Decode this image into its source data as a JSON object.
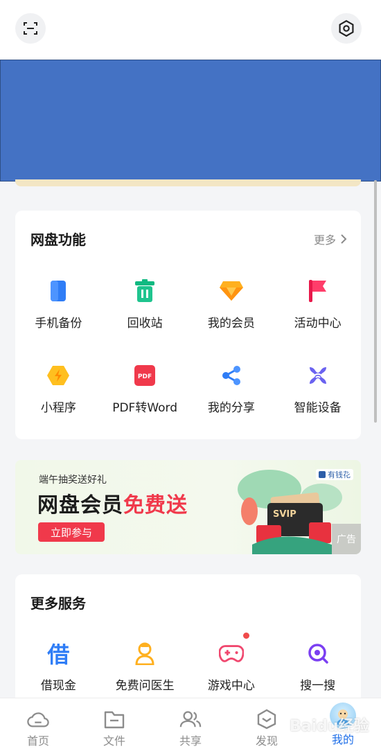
{
  "netdisk": {
    "title": "网盘功能",
    "more_label": "更多",
    "items": [
      {
        "label": "手机备份",
        "icon": "phone-backup-icon"
      },
      {
        "label": "回收站",
        "icon": "recycle-bin-icon"
      },
      {
        "label": "我的会员",
        "icon": "membership-diamond-icon"
      },
      {
        "label": "活动中心",
        "icon": "activity-flag-icon"
      },
      {
        "label": "小程序",
        "icon": "mini-program-icon"
      },
      {
        "label": "PDF转Word",
        "icon": "pdf-icon"
      },
      {
        "label": "我的分享",
        "icon": "share-icon"
      },
      {
        "label": "智能设备",
        "icon": "smart-device-icon"
      }
    ]
  },
  "banner": {
    "subtitle": "端午抽奖送好礼",
    "headline_black": "网盘会员",
    "headline_red": "免费送",
    "cta_label": "立即参与",
    "brand_label": "有钱花",
    "ad_tag": "广告",
    "ticket_label": "SVIP"
  },
  "services": {
    "title": "更多服务",
    "items": [
      {
        "label": "借现金",
        "glyph": "借",
        "icon": "loan-icon"
      },
      {
        "label": "免费问医生",
        "icon": "doctor-icon"
      },
      {
        "label": "游戏中心",
        "icon": "gamepad-icon"
      },
      {
        "label": "搜一搜",
        "icon": "search-icon"
      }
    ]
  },
  "tabbar": {
    "tabs": [
      {
        "label": "首页",
        "icon": "home-cloud-icon"
      },
      {
        "label": "文件",
        "icon": "folder-icon"
      },
      {
        "label": "共享",
        "icon": "share-people-icon"
      },
      {
        "label": "发现",
        "icon": "discover-icon"
      },
      {
        "label": "我的",
        "icon": "avatar-icon",
        "active": true
      }
    ]
  },
  "watermark": "Baidu经验",
  "colors": {
    "accent": "#1f6fe8",
    "promo_red": "#f0394b",
    "redacted_block": "#4472c4"
  }
}
